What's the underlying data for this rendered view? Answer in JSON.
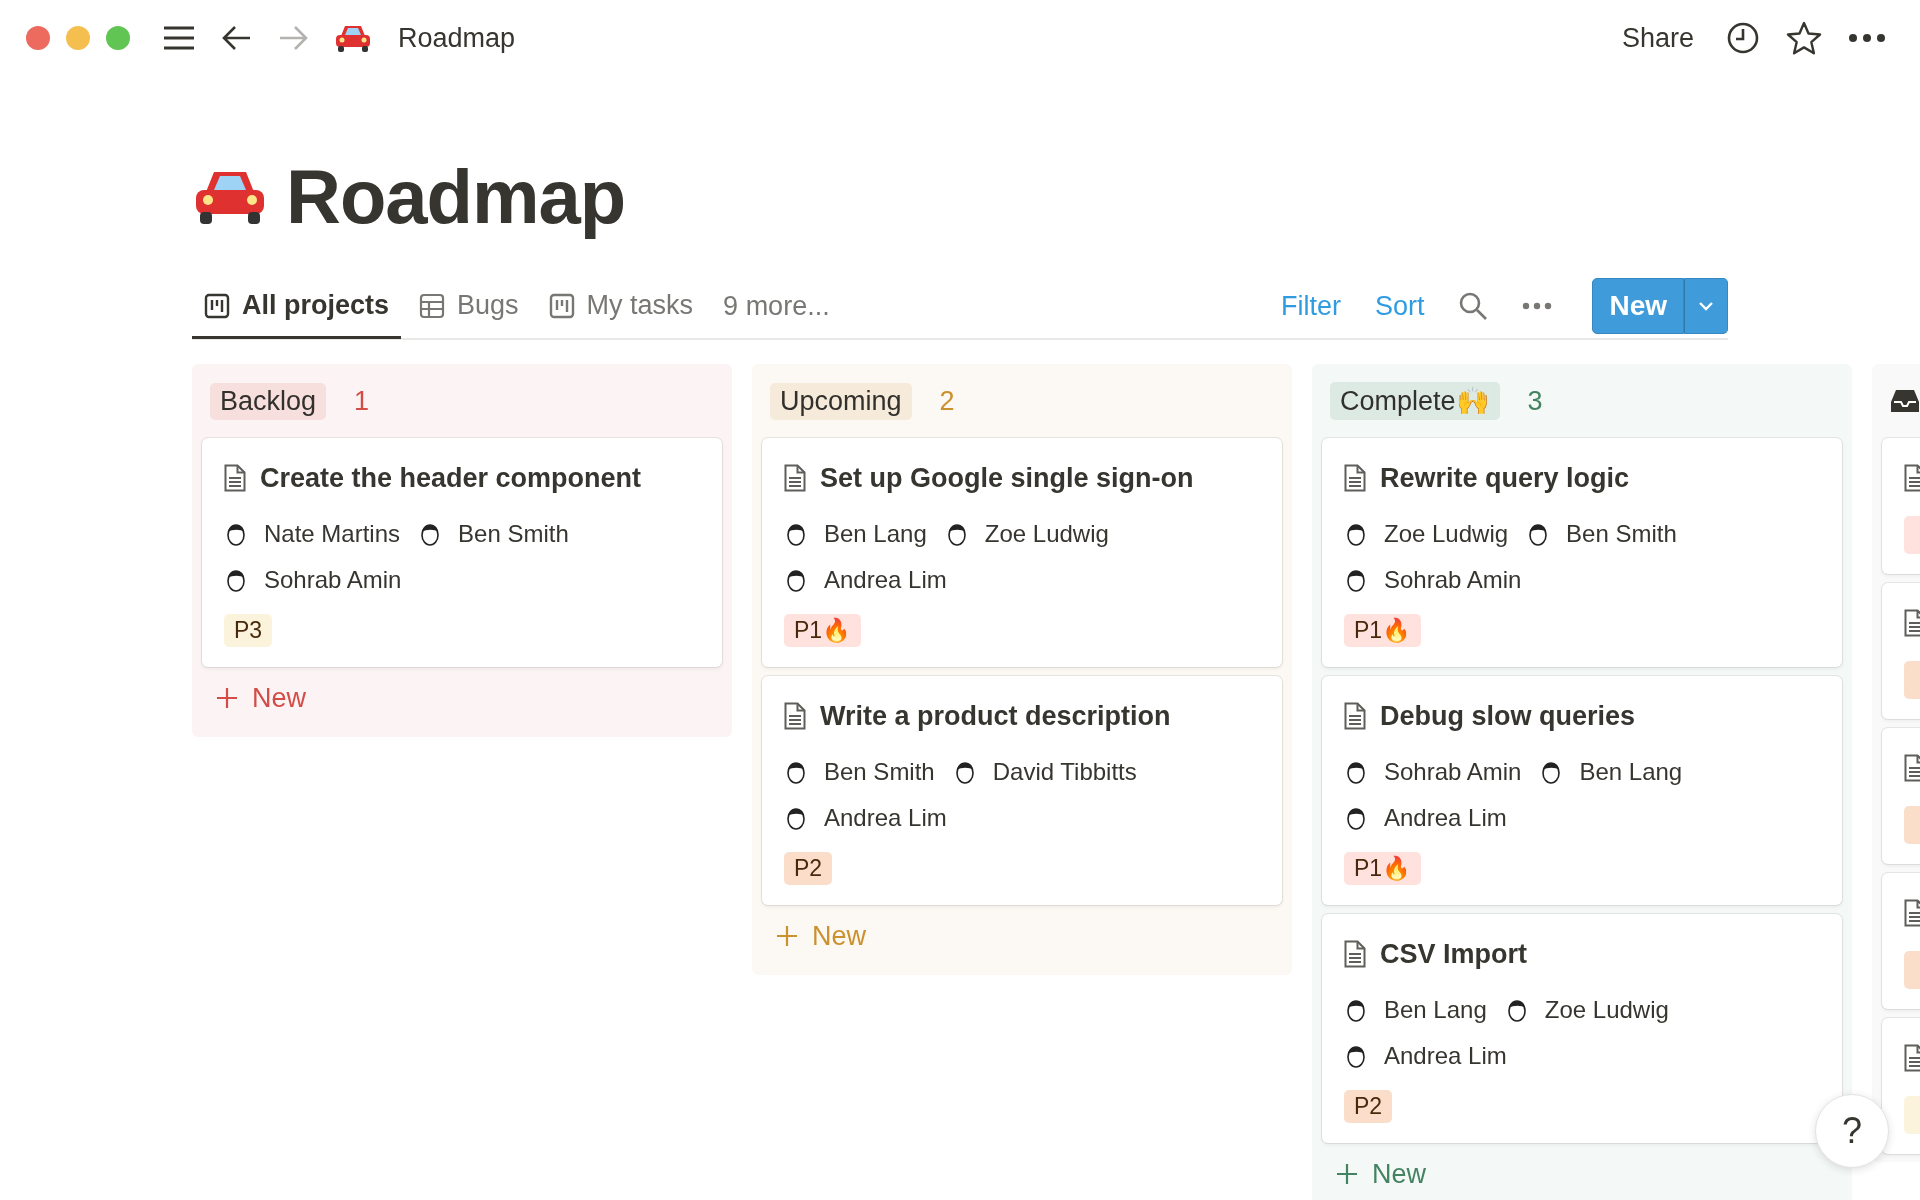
{
  "top_bar": {
    "page_title": "Roadmap",
    "share": "Share"
  },
  "page": {
    "title": "Roadmap"
  },
  "views": [
    {
      "label": "All projects",
      "kind": "board",
      "selected": true
    },
    {
      "label": "Bugs",
      "kind": "table",
      "selected": false
    },
    {
      "label": "My tasks",
      "kind": "board",
      "selected": false
    }
  ],
  "more_views": "9 more...",
  "toolbar": {
    "filter": "Filter",
    "sort": "Sort",
    "new": "New"
  },
  "columns": [
    {
      "kind": "status",
      "name": "Backlog",
      "count": "1",
      "color": "#d44c47",
      "add_label": "New",
      "cards": [
        {
          "title": "Create the header component",
          "people": [
            "Nate Martins",
            "Ben Smith",
            "Sohrab Amin"
          ],
          "tag": {
            "label": "P3",
            "color": "#fbf3db"
          }
        }
      ]
    },
    {
      "kind": "status",
      "name": "Upcoming",
      "count": "2",
      "color": "#cb912f",
      "add_label": "New",
      "cards": [
        {
          "title": "Set up Google single sign-on",
          "people": [
            "Ben Lang",
            "Zoe Ludwig",
            "Andrea Lim"
          ],
          "tag": {
            "label": "P1🔥",
            "color": "#ffe2dd"
          }
        },
        {
          "title": "Write a product description",
          "people": [
            "Ben Smith",
            "David Tibbitts",
            "Andrea Lim"
          ],
          "tag": {
            "label": "P2",
            "color": "#fadec9"
          }
        }
      ]
    },
    {
      "kind": "status",
      "name": "Complete🙌",
      "count": "3",
      "color": "#448361",
      "add_label": "New",
      "cards": [
        {
          "title": "Rewrite query logic",
          "people": [
            "Zoe Ludwig",
            "Ben Smith",
            "Sohrab Amin"
          ],
          "tag": {
            "label": "P1🔥",
            "color": "#ffe2dd"
          }
        },
        {
          "title": "Debug slow queries",
          "people": [
            "Sohrab Amin",
            "Ben Lang",
            "Andrea Lim"
          ],
          "tag": {
            "label": "P1🔥",
            "color": "#ffe2dd"
          }
        },
        {
          "title": "CSV Import",
          "people": [
            "Ben Lang",
            "Zoe Ludwig",
            "Andrea Lim"
          ],
          "tag": {
            "label": "P2",
            "color": "#fadec9"
          }
        }
      ]
    },
    {
      "kind": "no_status",
      "cards": [
        {
          "tag": {
            "color": "#ffe2dd"
          }
        },
        {
          "tag": {
            "color": "#fadec9"
          }
        },
        {
          "tag": {
            "color": "#fadec9"
          }
        },
        {
          "tag": {
            "color": "#fadec9"
          }
        },
        {
          "tag": {
            "color": "#fbf3db"
          }
        }
      ]
    }
  ],
  "help": "?"
}
